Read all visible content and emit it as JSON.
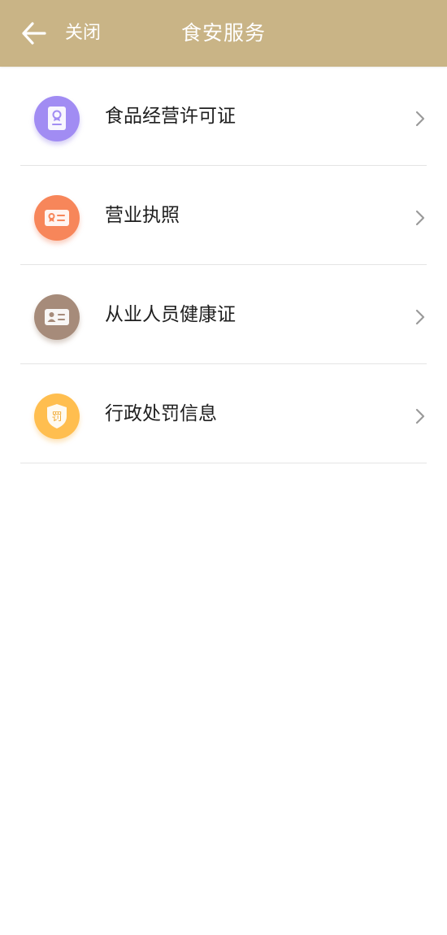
{
  "header": {
    "title": "食安服务",
    "close_label": "关闭",
    "background_color": "#c9b486"
  },
  "services": [
    {
      "label": "食品经营许可证",
      "icon": "license-certificate-icon",
      "color": "#a18cf3"
    },
    {
      "label": "营业执照",
      "icon": "business-license-icon",
      "color": "#f7865a"
    },
    {
      "label": "从业人员健康证",
      "icon": "health-certificate-icon",
      "color": "#a68b7a"
    },
    {
      "label": "行政处罚信息",
      "icon": "penalty-shield-icon",
      "color": "#ffbe4f"
    }
  ],
  "penalty_icon_glyph": "罚"
}
